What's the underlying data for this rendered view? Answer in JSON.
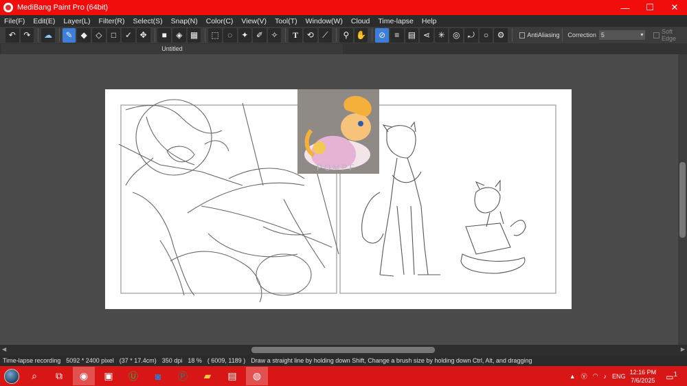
{
  "window": {
    "title": "MediBang Paint Pro (64bit)",
    "controls": [
      "minimize",
      "maximize",
      "close"
    ]
  },
  "menu": [
    "File(F)",
    "Edit(E)",
    "Layer(L)",
    "Filter(R)",
    "Select(S)",
    "Snap(N)",
    "Color(C)",
    "View(V)",
    "Tool(T)",
    "Window(W)",
    "Cloud",
    "Time-lapse",
    "Help"
  ],
  "toolbar": {
    "antialiasing_label": "AntiAliasing",
    "correction_label": "Correction",
    "correction_value": "5",
    "soft_edge_label": "Soft Edge"
  },
  "document": {
    "tab_title": "Untitled"
  },
  "status": {
    "recording": "Time-lapse recording",
    "size_px": "5092 * 2400 pixel",
    "size_cm": "(37 * 17.4cm)",
    "dpi": "350 dpi",
    "zoom": "18 %",
    "cursor": "( 6009, 1189 )",
    "hint": "Draw a straight line by holding down Shift, Change a brush size by holding down Ctrl, Alt, and dragging"
  },
  "taskbar": {
    "apps": [
      "chrome",
      "store",
      "upwork",
      "outlook",
      "publisher",
      "folder",
      "calendar",
      "medibang"
    ],
    "language": "ENG",
    "time": "12:16 PM",
    "date": "7/6/2025",
    "notifications": "1"
  },
  "colors": {
    "titlebar": "#f20d0d",
    "taskbar": "#d81616",
    "active_tool": "#3b7fd8"
  }
}
